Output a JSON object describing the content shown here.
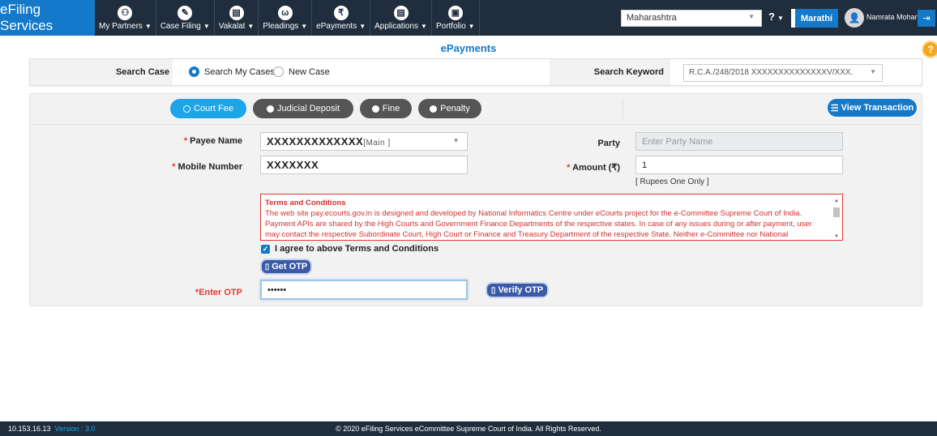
{
  "nav": {
    "brand": "eFiling Services",
    "items": [
      {
        "label": "My Partners",
        "icon": "partners-icon"
      },
      {
        "label": "Case Filing",
        "icon": "pencil-icon"
      },
      {
        "label": "Vakalat",
        "icon": "document-icon"
      },
      {
        "label": "Pleadings",
        "icon": "pleadings-icon"
      },
      {
        "label": "ePayments",
        "icon": "rupee-icon"
      },
      {
        "label": "Applications",
        "icon": "document-icon"
      },
      {
        "label": "Portfolio",
        "icon": "briefcase-icon"
      }
    ],
    "state": "Maharashtra",
    "help": "?",
    "language": "Marathi",
    "user": "Namrata Mohan..."
  },
  "page": {
    "title": "ePayments"
  },
  "search": {
    "case_label": "Search Case",
    "option_my": "Search My Cases",
    "option_new": "New Case",
    "keyword_label": "Search Keyword",
    "keyword_value": "R.C.A./248/2018 XXXXXXXXXXXXXXV/XXX."
  },
  "tabs": {
    "court_fee": "Court Fee",
    "judicial_deposit": "Judicial Deposit",
    "fine": "Fine",
    "penalty": "Penalty",
    "view_transaction": "View Transaction"
  },
  "form": {
    "payee_label": "Payee Name",
    "payee_value": "XXXXXXXXXXXXX",
    "payee_suffix": "[Main ]",
    "party_label": "Party",
    "party_placeholder": "Enter Party Name",
    "mobile_label": "Mobile Number",
    "mobile_value": "XXXXXXX",
    "amount_label": "Amount (₹)",
    "amount_value": "1",
    "amount_words": "[ Rupees One Only ]",
    "terms_title": "Terms and Conditions",
    "terms_text": "The web site pay.ecourts.gov.in is designed and developed by National Informatics Centre under eCourts project for the e-Committee Supreme Court of India. Payment APIs are shared by the High Courts and Government Finance Departments of the respective states. In case of any issues during or after payment, user may contact the respective Subordinate Court, High Court or Finance and Treasury Department of the respective State. Neither e-Committee nor National Informatics",
    "agree_label": "I agree to above Terms and Conditions",
    "get_otp": "Get OTP",
    "otp_label": "*Enter OTP",
    "otp_value": "••••••",
    "verify_otp": "Verify OTP"
  },
  "footer": {
    "ip": "10.153.16.13",
    "version": "Version : 3.0",
    "copyright": "© 2020 eFiling Services eCommittee Supreme Court of India. All Rights Reserved."
  },
  "colors": {
    "accent": "#1479c9",
    "nav": "#1f2d3d",
    "required": "#e53935"
  }
}
